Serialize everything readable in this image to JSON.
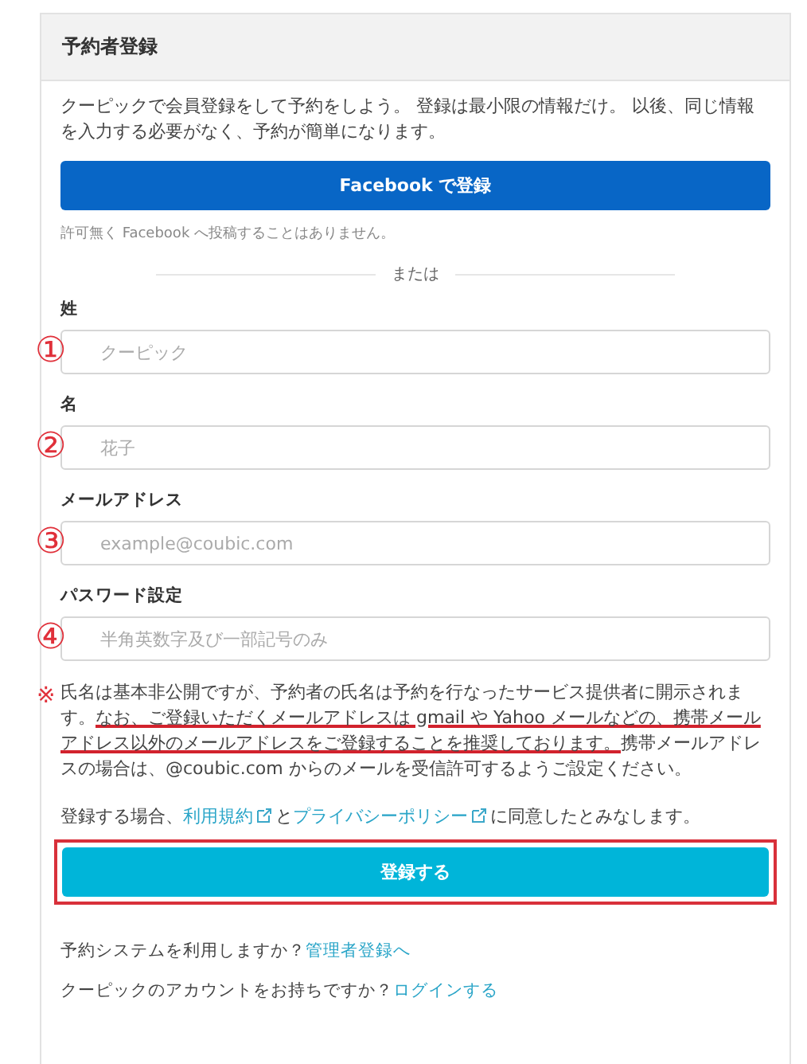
{
  "header": {
    "title": "予約者登録"
  },
  "intro": "クーピックで会員登録をして予約をしよう。 登録は最小限の情報だけ。 以後、同じ情報を入力する必要がなく、予約が簡単になります。",
  "facebook_button": "Facebook で登録",
  "facebook_note": "許可無く Facebook へ投稿することはありません。",
  "divider_label": "または",
  "fields": [
    {
      "label": "姓",
      "placeholder": "クーピック",
      "marker": "①"
    },
    {
      "label": "名",
      "placeholder": "花子",
      "marker": "②"
    },
    {
      "label": "メールアドレス",
      "placeholder": "example@coubic.com",
      "marker": "③"
    },
    {
      "label": "パスワード設定",
      "placeholder": "半角英数字及び一部記号のみ",
      "marker": "④"
    }
  ],
  "note": {
    "before": "氏名は基本非公開ですが、予約者の氏名は予約を行なったサービス提供者に開示されます。",
    "underlined": "なお、ご登録いただくメールアドレスは gmail や Yahoo メールなどの、携帯メールアドレス以外のメールアドレスをご登録することを推奨しております。",
    "after": "携帯メールアドレスの場合は、@coubic.com からのメールを受信許可するようご設定ください。",
    "mark": "※"
  },
  "agreement": {
    "before": "登録する場合、",
    "link1": "利用規約",
    "middle": "と",
    "link2": "プライバシーポリシー",
    "after": "に同意したとみなします。"
  },
  "submit_button": {
    "label": "登録する",
    "highlighted": true
  },
  "footer_lines": [
    {
      "text": "予約システムを利用しますか？",
      "link": "管理者登録へ"
    },
    {
      "text": "クーピックのアカウントをお持ちですか？",
      "link": "ログインする"
    }
  ]
}
